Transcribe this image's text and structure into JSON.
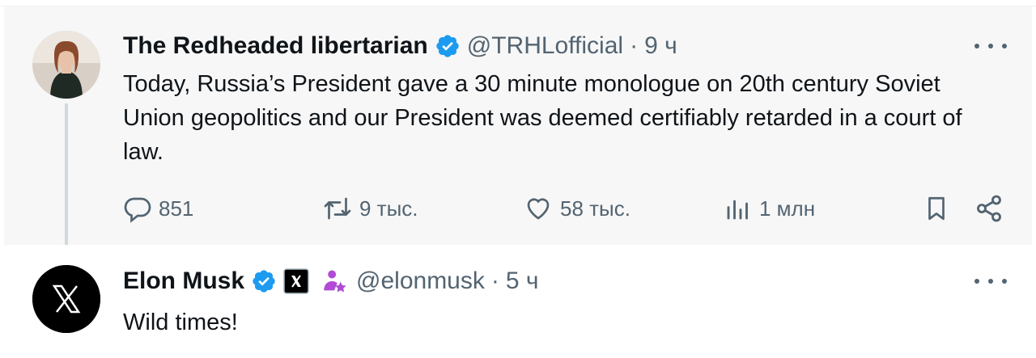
{
  "tweet1": {
    "name": "The Redheaded libertarian",
    "handle": "@TRHLofficial",
    "sep": "·",
    "time": "9 ч",
    "text": "Today, Russia’s President gave a 30 minute monologue on 20th century Soviet Union geopolitics and our President was deemed certifiably retarded in a court of law.",
    "replies": "851",
    "reposts": "9 тыс.",
    "likes": "58 тыс.",
    "views": "1 млн"
  },
  "tweet2": {
    "name": "Elon Musk",
    "handle": "@elonmusk",
    "sep": "·",
    "time": "5 ч",
    "text": "Wild times!"
  },
  "colors": {
    "verified": "#1d9bf0",
    "affiliate_badge": "#b14bd6",
    "muted": "#536471"
  }
}
